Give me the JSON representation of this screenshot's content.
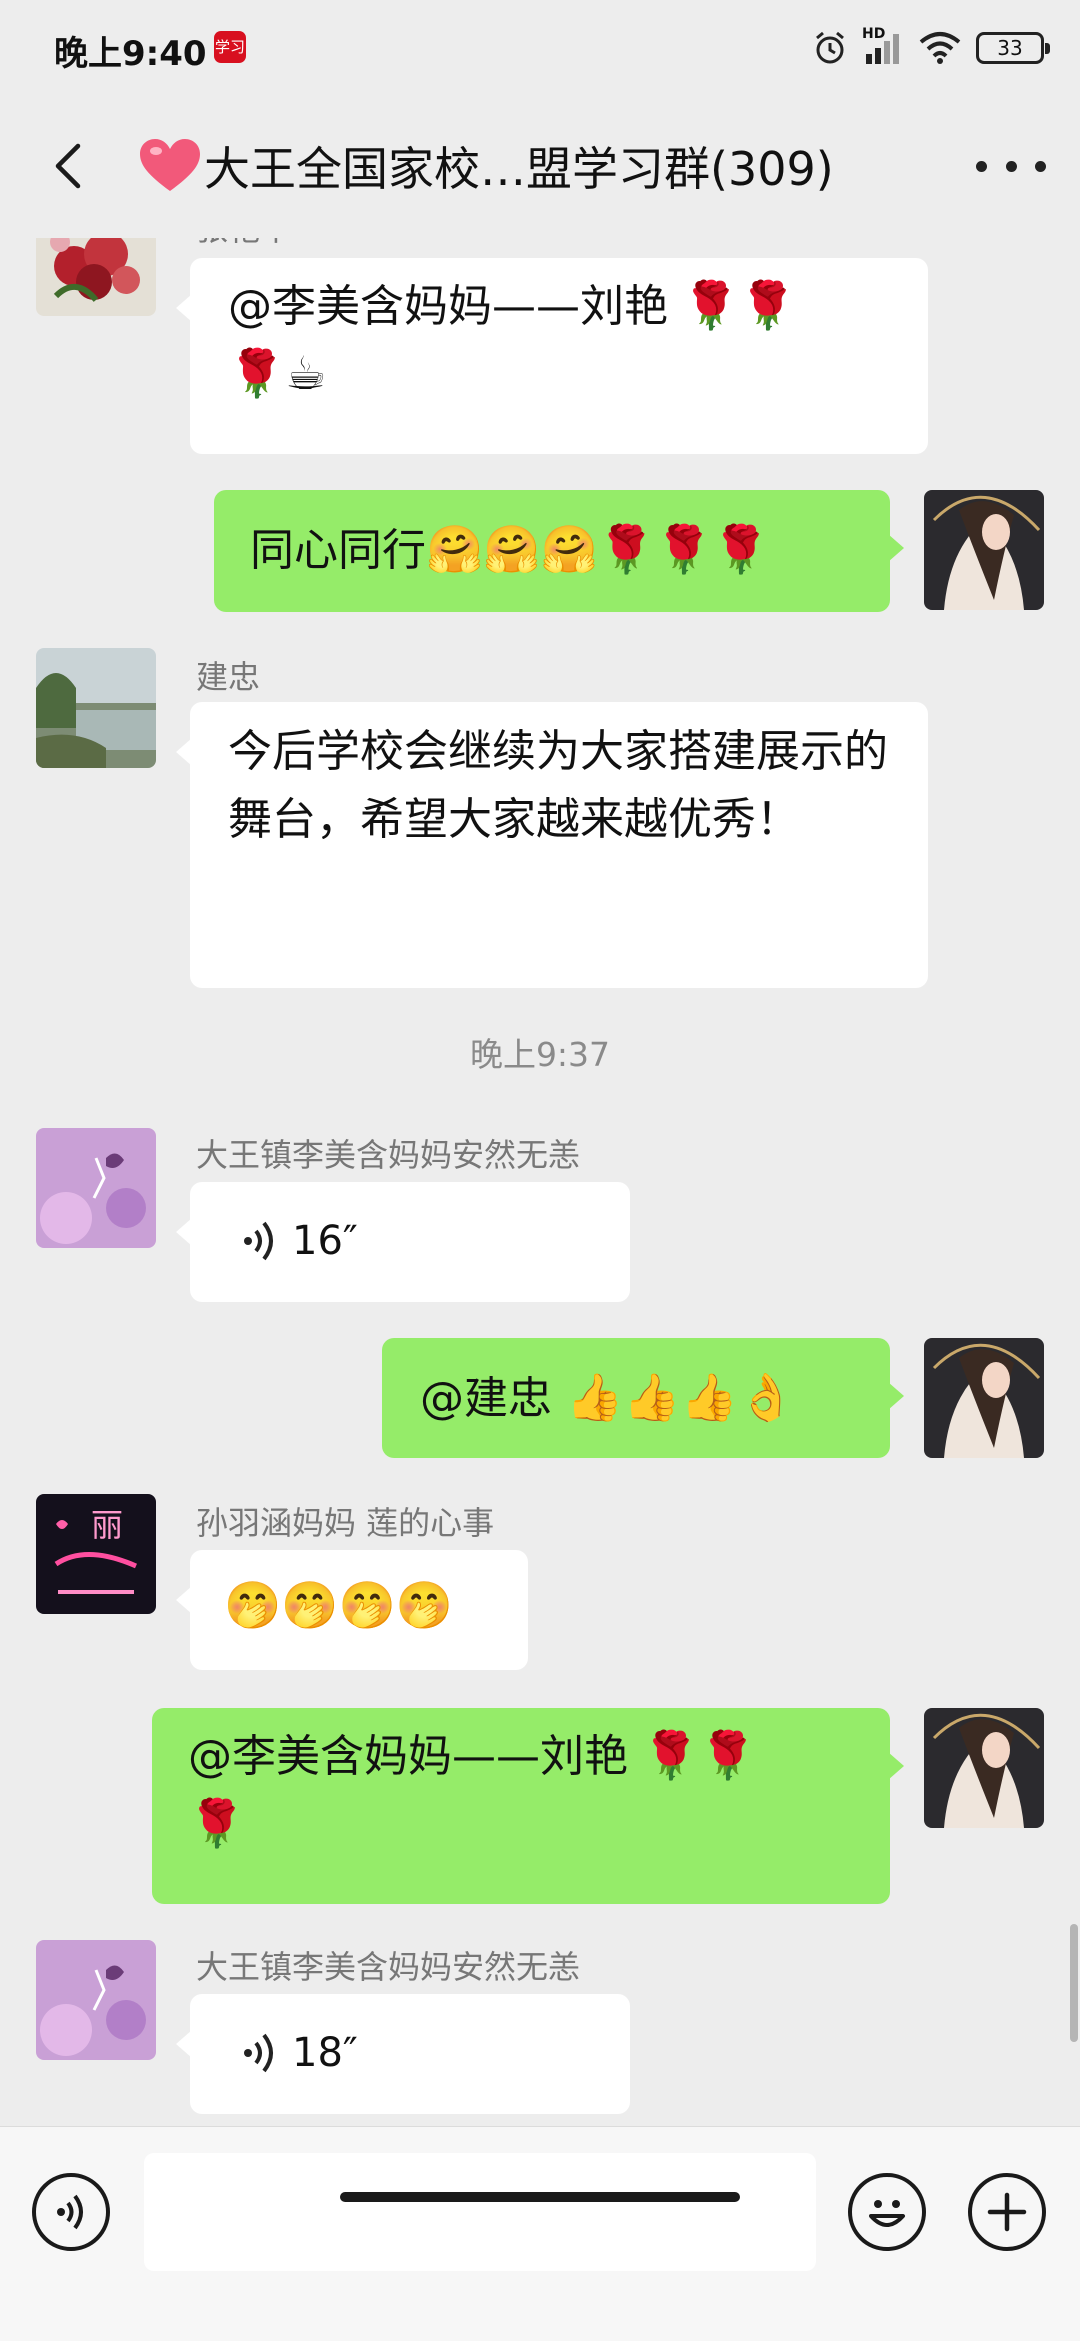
{
  "status_bar": {
    "time": "晚上9:40",
    "app_badge": "学习",
    "network_label": "HD",
    "battery": "33"
  },
  "header": {
    "title": "大王全国家校…盟学习群(309)"
  },
  "messages": {
    "m1": {
      "sender": "张艳平",
      "text": "@李美含妈妈——刘艳",
      "emoji": "🌹🌹",
      "emoji2": "🌹☕"
    },
    "m2": {
      "text": "同心同行",
      "emoji": "🤗🤗🤗🌹🌹🌹"
    },
    "m3": {
      "sender": "建忠",
      "text": "今后学校会继续为大家搭建展示的舞台，希望大家越来越优秀！"
    },
    "ts": "晚上9:37",
    "m4": {
      "sender": "大王镇李美含妈妈安然无恙",
      "duration": "16″"
    },
    "m5": {
      "text": "@建忠",
      "emoji": "👍👍👍👌"
    },
    "m6": {
      "sender": "孙羽涵妈妈  莲的心事",
      "emoji": "🤭🤭🤭🤭"
    },
    "m7": {
      "text": "@李美含妈妈——刘艳",
      "emoji": "🌹🌹",
      "emoji2": "🌹"
    },
    "m8": {
      "sender": "大王镇李美含妈妈安然无恙",
      "duration": "18″"
    }
  },
  "avatar_text": {
    "lili": "丽"
  },
  "colors": {
    "background": "#ededed",
    "bubble_out": "#95ec69",
    "bubble_in": "#ffffff"
  },
  "icons": [
    "back-icon",
    "heart-icon",
    "more-icon",
    "voice-icon",
    "emoji-icon",
    "add-icon",
    "alarm-icon",
    "signal-icon",
    "wifi-icon",
    "battery-icon"
  ]
}
